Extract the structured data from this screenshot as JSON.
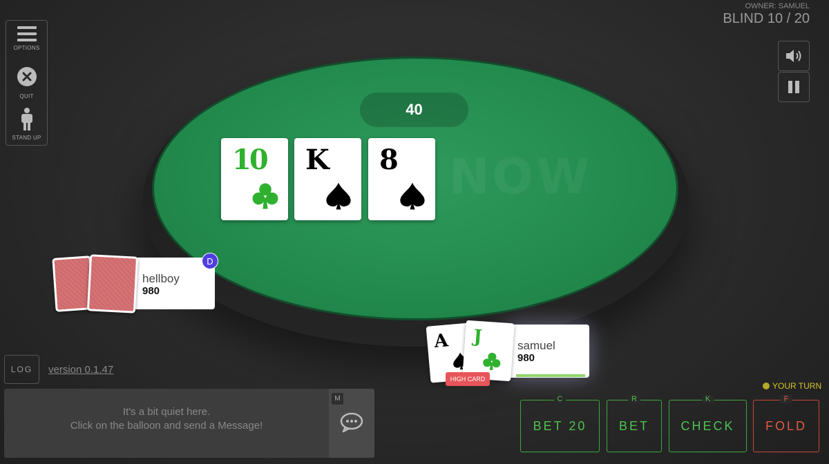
{
  "header": {
    "owner": "OWNER: SAMUEL",
    "blind": "BLIND 10 / 20"
  },
  "menu": {
    "options_label": "OPTIONS",
    "quit_label": "QUIT",
    "standup_label": "STAND UP"
  },
  "table": {
    "pot": "40",
    "watermark": "NOW",
    "community_cards": [
      {
        "rank": "10",
        "suit": "clubs",
        "color": "#2fb12f"
      },
      {
        "rank": "K",
        "suit": "spades",
        "color": "#000000"
      },
      {
        "rank": "8",
        "suit": "spades",
        "color": "#000000"
      }
    ]
  },
  "players": {
    "opponent": {
      "name": "hellboy",
      "stack": "980",
      "dealer_badge": "D"
    },
    "me": {
      "name": "samuel",
      "stack": "980",
      "hand_label": "HIGH CARD",
      "cards": [
        {
          "rank": "A",
          "suit": "spades",
          "color": "#000000"
        },
        {
          "rank": "J",
          "suit": "clubs",
          "color": "#2fb12f"
        }
      ]
    }
  },
  "footer": {
    "log_label": "LOG",
    "version": "version 0.1.47",
    "chat_placeholder_line1": "It's a bit quiet here.",
    "chat_placeholder_line2": "Click on the balloon and send a Message!",
    "chat_hotkey": "M"
  },
  "actions": {
    "your_turn": "YOUR TURN",
    "buttons": [
      {
        "label": "BET 20",
        "hotkey": "C"
      },
      {
        "label": "BET",
        "hotkey": "R"
      },
      {
        "label": "CHECK",
        "hotkey": "K"
      },
      {
        "label": "FOLD",
        "hotkey": "F"
      }
    ]
  },
  "icons": {
    "menu": "hamburger-icon",
    "quit": "close-circle-icon",
    "standup": "person-standing-icon",
    "sound": "speaker-icon",
    "pause": "pause-icon",
    "chat": "chat-balloon-icon",
    "club": "club-suit-icon",
    "spade": "spade-suit-icon"
  },
  "colors": {
    "felt": "#228a4d",
    "action_green": "#4ec24e",
    "fold_red": "#e05a44",
    "back_card": "#d06a6d",
    "dealer": "#4f3fe0",
    "hand_badge": "#e8555a",
    "your_turn": "#d4c42a"
  }
}
